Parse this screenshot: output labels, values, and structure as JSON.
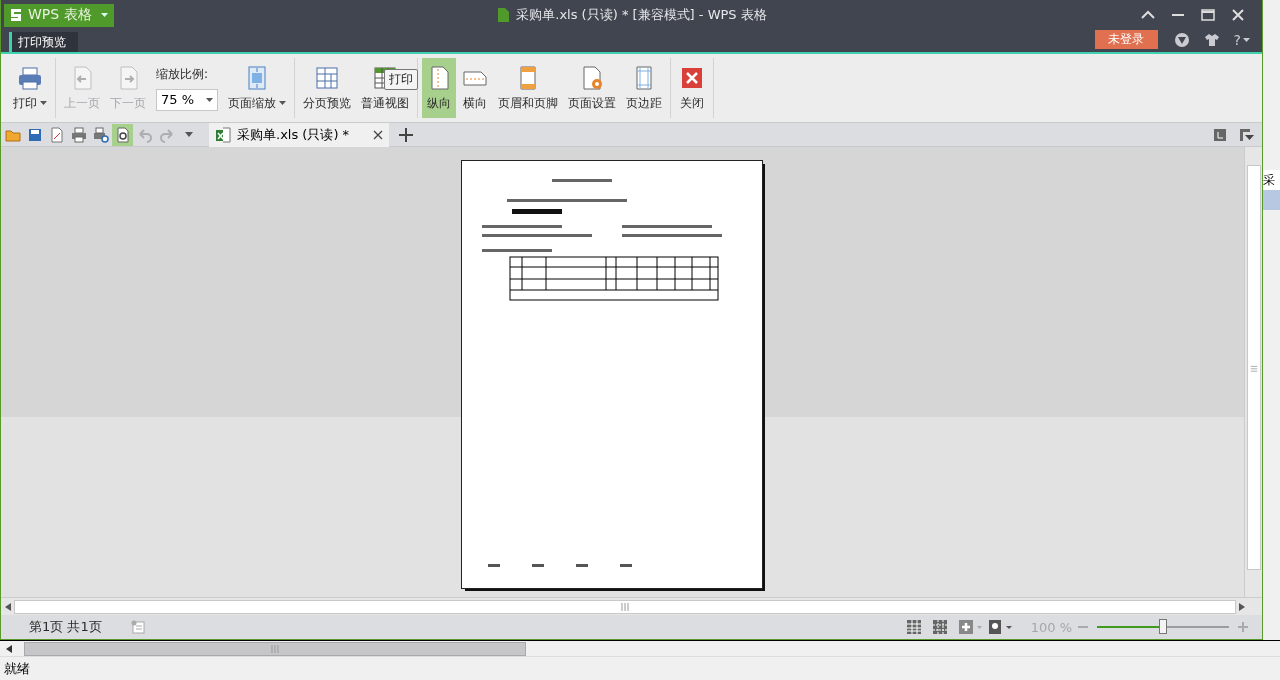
{
  "app_menu": {
    "label": "WPS 表格"
  },
  "window": {
    "title": "采购单.xls (只读) * [兼容模式] - WPS 表格"
  },
  "ribbon_tabs": [
    {
      "label": "打印预览",
      "selected": true
    }
  ],
  "login_button": {
    "label": "未登录"
  },
  "help_button": {
    "label": "?"
  },
  "ribbon": {
    "groups": [
      [
        {
          "kind": "button",
          "label": "打印",
          "dropdown": true,
          "disabled": false,
          "selected": false
        }
      ],
      [
        {
          "kind": "button",
          "label": "上一页",
          "dropdown": false,
          "disabled": true,
          "selected": false
        },
        {
          "kind": "button",
          "label": "下一页",
          "dropdown": false,
          "disabled": true,
          "selected": false
        },
        {
          "kind": "zoom",
          "label": "缩放比例:",
          "value": "75 %"
        },
        {
          "kind": "button",
          "label": "页面缩放",
          "dropdown": true,
          "disabled": false,
          "selected": false
        }
      ],
      [
        {
          "kind": "button",
          "label": "分页预览",
          "dropdown": false,
          "disabled": false,
          "selected": false
        },
        {
          "kind": "button",
          "label": "普通视图",
          "dropdown": false,
          "disabled": false,
          "selected": false
        }
      ],
      [
        {
          "kind": "button",
          "label": "纵向",
          "dropdown": false,
          "disabled": false,
          "selected": true
        },
        {
          "kind": "button",
          "label": "横向",
          "dropdown": false,
          "disabled": false,
          "selected": false
        },
        {
          "kind": "button",
          "label": "页眉和页脚",
          "dropdown": false,
          "disabled": false,
          "selected": false
        },
        {
          "kind": "button",
          "label": "页面设置",
          "dropdown": false,
          "disabled": false,
          "selected": false
        },
        {
          "kind": "button",
          "label": "页边距",
          "dropdown": false,
          "disabled": false,
          "selected": false
        }
      ],
      [
        {
          "kind": "button",
          "label": "关闭",
          "dropdown": false,
          "disabled": false,
          "selected": false
        }
      ]
    ]
  },
  "tooltip": {
    "label": "打印"
  },
  "quick_toolbar": [
    {
      "disabled": false,
      "selected": false
    },
    {
      "disabled": false,
      "selected": false
    },
    {
      "disabled": false,
      "selected": false
    },
    {
      "disabled": false,
      "selected": false
    },
    {
      "disabled": false,
      "selected": false
    },
    {
      "disabled": false,
      "selected": true
    },
    {
      "disabled": true,
      "selected": false
    },
    {
      "disabled": true,
      "selected": false
    }
  ],
  "document_tabs": [
    {
      "label": "采购单.xls (只读) *",
      "selected": true
    }
  ],
  "behind_sheet": {
    "label": "采"
  },
  "status_bar": {
    "pages": "第1页 共1页",
    "zoom": "100 %",
    "zoom_slider": {
      "level": 0.5
    }
  },
  "app_status": {
    "label": "就绪"
  }
}
